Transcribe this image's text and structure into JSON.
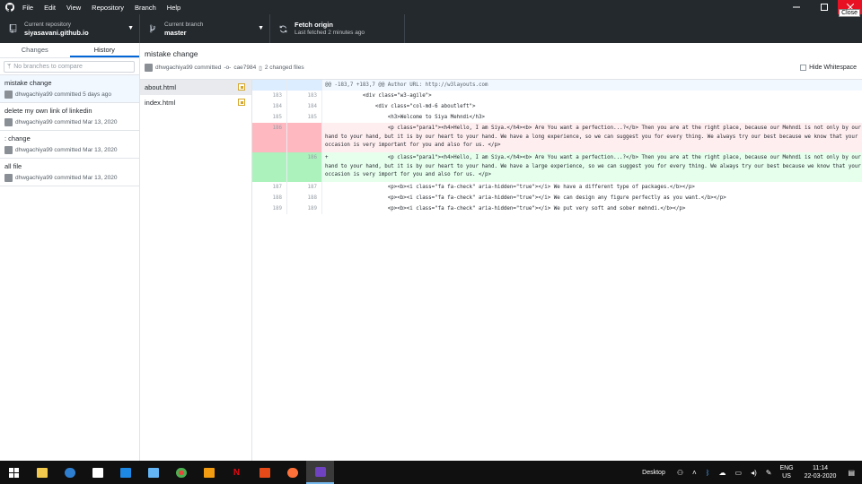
{
  "menu": {
    "items": [
      "File",
      "Edit",
      "View",
      "Repository",
      "Branch",
      "Help"
    ]
  },
  "window": {
    "close_tooltip": "Close"
  },
  "toolbar": {
    "repo_label": "Current repository",
    "repo_value": "siyasavani.github.io",
    "branch_label": "Current branch",
    "branch_value": "master",
    "fetch_title": "Fetch origin",
    "fetch_subtitle": "Last fetched 2 minutes ago"
  },
  "sidebar": {
    "tabs": [
      "Changes",
      "History"
    ],
    "active_tab": "History",
    "compare_placeholder": "No branches to compare",
    "commits": [
      {
        "title": "mistake change",
        "meta": "dhwgachiya99 committed 5 days ago"
      },
      {
        "title": "delete my own link of linkedin",
        "meta": "dhwgachiya99 committed Mar 13, 2020"
      },
      {
        "title": ": change",
        "meta": "dhwgachiya99 committed Mar 13, 2020"
      },
      {
        "title": "all file",
        "meta": "dhwgachiya99 committed Mar 13, 2020"
      }
    ]
  },
  "commit": {
    "title": "mistake change",
    "author": "dhwgachiya99 committed",
    "sha": "cae7984",
    "changed": "2 changed files",
    "hide_whitespace": "Hide Whitespace"
  },
  "files": [
    "about.html",
    "index.html"
  ],
  "diff": {
    "hunk": "@@ -183,7 +183,7 @@ Author URL: http://w3layouts.com",
    "lines": [
      {
        "old": "183",
        "new": "183",
        "type": "ctx",
        "text": "            <div class=\"w3-agile\">"
      },
      {
        "old": "184",
        "new": "184",
        "type": "ctx",
        "text": "                <div class=\"col-md-6 aboutleft\">"
      },
      {
        "old": "185",
        "new": "185",
        "type": "ctx",
        "text": "                    <h3>Welcome to Siya Mehndi</h3>"
      },
      {
        "old": "186",
        "new": "",
        "type": "del",
        "text": "                    <p class=\"para1\"><h4>Hello, I am Siya.</h4><b> Are You want a perfection...?</b> Then you are at the right place, because our Mehndi is not only by our hand to your hand, but it is by our heart to your hand. We have a long experience, so we can suggest you for every thing. We always try our best because we know that your occasion is very important for you and also for us. </p>"
      },
      {
        "old": "",
        "new": "186",
        "type": "add",
        "text": "+                   <p class=\"para1\"><h4>Hello, I am Siya.</h4><b> Are You want a perfection...?</b> Then you are at the right place, because our Mehndi is not only by our hand to your hand, but it is by our heart to your hand. We have a large experience, so we can suggest you for every thing. We always try our best because we know that your occasion is very import for you and also for us. </p>"
      },
      {
        "old": "187",
        "new": "187",
        "type": "ctx",
        "text": "                    <p><b><i class=\"fa fa-check\" aria-hidden=\"true\"></i> We have a different type of packages.</b></p>"
      },
      {
        "old": "188",
        "new": "188",
        "type": "ctx",
        "text": "                    <p><b><i class=\"fa fa-check\" aria-hidden=\"true\"></i> We can design any figure perfectly as you want.</b></p>"
      },
      {
        "old": "189",
        "new": "189",
        "type": "ctx",
        "text": "                    <p><b><i class=\"fa fa-check\" aria-hidden=\"true\"></i> We put very soft and sober mehndi.</b></p>"
      }
    ]
  },
  "taskbar": {
    "desktop_label": "Desktop",
    "lang": "ENG",
    "region": "US",
    "time": "11:14",
    "date": "22-03-2020"
  },
  "colors": {
    "accent": "#0366d6",
    "titlebar": "#24292e",
    "close": "#e81123"
  }
}
